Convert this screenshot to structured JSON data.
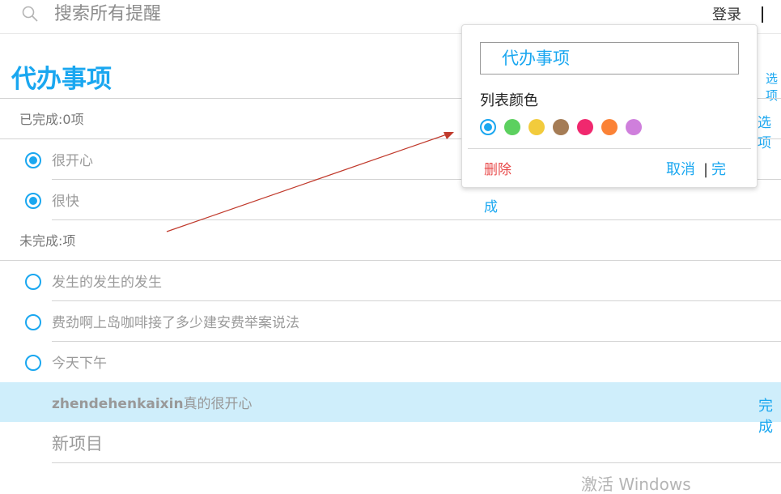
{
  "search": {
    "placeholder": "搜索所有提醒",
    "icon": "search-icon"
  },
  "header": {
    "login_label": "登录"
  },
  "list": {
    "title": "代办事项",
    "options_label_top": "选项",
    "options_label": "选项",
    "completed_label": "已完成:0项",
    "completed_items": [
      {
        "text": "很开心",
        "checked": true
      },
      {
        "text": "很快",
        "checked": true
      }
    ],
    "incomplete_label": "未完成:项",
    "incomplete_items": [
      {
        "text": "发生的发生的发生",
        "checked": false
      },
      {
        "text": "费劲啊上岛咖啡接了多少建安费举案说法",
        "checked": false
      },
      {
        "text": "今天下午",
        "checked": false
      }
    ],
    "editing_item": {
      "bold": "zhendehenkaixin",
      "rest": "真的很开心",
      "done_label": "完成"
    },
    "new_item_placeholder": "新项目"
  },
  "popup": {
    "name_value": "代办事项",
    "color_label": "列表颜色",
    "colors": [
      "#1aa7f0",
      "#5cd05f",
      "#f2cb3c",
      "#a57c55",
      "#f0286e",
      "#fb8236",
      "#cf7fdc"
    ],
    "selected_color": "#1aa7f0",
    "delete_label": "删除",
    "cancel_label": "取消",
    "separator": "|",
    "finish_label_part1": "完",
    "finish_label_part2": "成"
  },
  "watermark": "激活 Windows"
}
